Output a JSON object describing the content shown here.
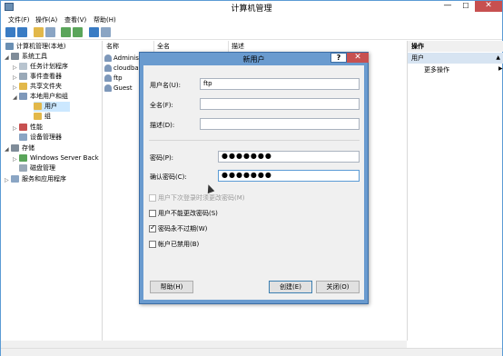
{
  "window": {
    "title": "计算机管理",
    "min": "—",
    "max": "☐",
    "close": "✕"
  },
  "menu": [
    "文件(F)",
    "操作(A)",
    "查看(V)",
    "帮助(H)"
  ],
  "tree": {
    "items": [
      {
        "label": "计算机管理(本地)",
        "icon": "computer-icon"
      },
      {
        "label": "系统工具",
        "icon": "tools-icon"
      },
      {
        "label": "任务计划程序",
        "icon": "clock-icon"
      },
      {
        "label": "事件查看器",
        "icon": "event-icon"
      },
      {
        "label": "共享文件夹",
        "icon": "folder-icon"
      },
      {
        "label": "本地用户和组",
        "icon": "users-icon"
      },
      {
        "label": "用户",
        "icon": "folder-icon"
      },
      {
        "label": "组",
        "icon": "folder-icon"
      },
      {
        "label": "性能",
        "icon": "performance-icon"
      },
      {
        "label": "设备管理器",
        "icon": "device-icon"
      },
      {
        "label": "存储",
        "icon": "storage-icon"
      },
      {
        "label": "Windows Server Back",
        "icon": "backup-icon"
      },
      {
        "label": "磁盘管理",
        "icon": "disk-icon"
      },
      {
        "label": "服务和应用程序",
        "icon": "services-icon"
      }
    ]
  },
  "list": {
    "columns": [
      "名称",
      "全名",
      "描述"
    ],
    "rows": [
      "Adminis",
      "cloudba",
      "ftp",
      "Guest"
    ]
  },
  "actions": {
    "header": "操作",
    "section": "用户",
    "more": "更多操作"
  },
  "dialog": {
    "title": "新用户",
    "help_q": "?",
    "close": "✕",
    "username_label": "用户名(U):",
    "username_value": "ftp",
    "fullname_label": "全名(F):",
    "fullname_value": "",
    "desc_label": "描述(D):",
    "desc_value": "",
    "password_label": "密码(P):",
    "password_value": "●●●●●●●",
    "confirm_label": "确认密码(C):",
    "confirm_value": "●●●●●●●",
    "options": [
      {
        "label": "用户下次登录时须更改密码(M)",
        "checked": false,
        "disabled": true
      },
      {
        "label": "用户不能更改密码(S)",
        "checked": false,
        "disabled": false
      },
      {
        "label": "密码永不过期(W)",
        "checked": true,
        "disabled": false
      },
      {
        "label": "帐户已禁用(B)",
        "checked": false,
        "disabled": false
      }
    ],
    "help_button": "帮助(H)",
    "create_button": "创建(E)",
    "close_button": "关闭(O)"
  }
}
